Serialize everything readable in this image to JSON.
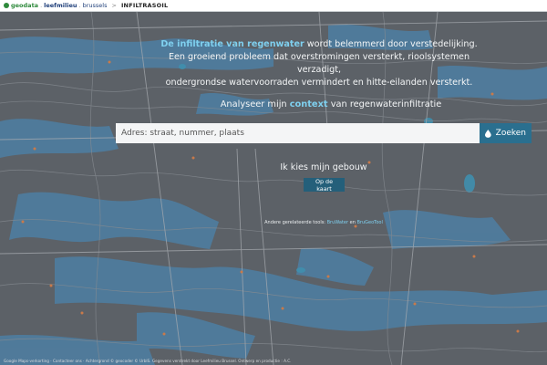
{
  "header": {
    "brand_geodata": "geodata",
    "brand_leefmilieu": "leefmilieu",
    "brand_brussels": "brussels",
    "separator": ">",
    "app_name": "INFILTRASOIL"
  },
  "hero": {
    "line1_highlight": "De infiltratie van regenwater",
    "line1_rest": " wordt belemmerd door verstedelijking.",
    "line2": "Een groeiend probleem dat overstromingen versterkt, rioolsystemen verzadigt,",
    "line3": "ondergrondse watervoorraden vermindert en hitte-eilanden versterkt."
  },
  "analyse": {
    "prefix": "Analyseer mijn ",
    "highlight": "context",
    "suffix": " van regenwaterinfiltratie"
  },
  "search": {
    "placeholder": "Adres: straat, nummer, plaats",
    "button_label": "Zoeken"
  },
  "building": {
    "label": "Ik kies mijn gebouw",
    "button_label": "Op de kaart"
  },
  "tools": {
    "prefix": "Andere gerelateerde tools: ",
    "tool1": "BruWater",
    "and": " en ",
    "tool2": "BruGeoTool"
  },
  "footer": {
    "text": "Google Maps-verkorting · Contacteer ons · Achtergrond © geocoder © UrbIS. Gegevens verstrekt door Leefmilieu Brussel. Ontwerp en productie : A.C."
  },
  "colors": {
    "accent": "#7fd0ef",
    "button": "#2a6f8f",
    "map_base": "#5b6066",
    "water_zone": "#4d7fa3"
  }
}
